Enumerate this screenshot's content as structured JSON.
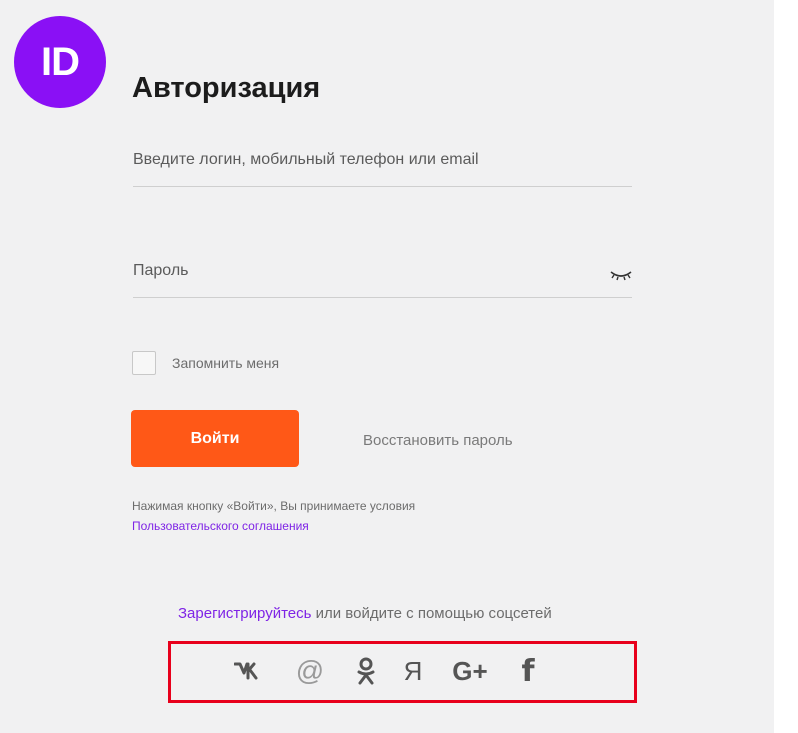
{
  "logo": {
    "text": "ID",
    "color": "#8a10f5"
  },
  "page": {
    "title": "Авторизация"
  },
  "login": {
    "placeholder": "Введите логин, мобильный телефон или email"
  },
  "password": {
    "placeholder": "Пароль",
    "toggle_icon": "eye-closed-icon"
  },
  "remember": {
    "label": "Запомнить меня",
    "checked": false
  },
  "actions": {
    "login_label": "Войти",
    "login_color": "#ff5817",
    "restore_label": "Восстановить пароль"
  },
  "terms": {
    "text": "Нажимая кнопку «Войти», Вы принимаете условия",
    "link": "Пользовательского соглашения"
  },
  "signup": {
    "link": "Зарегистрируйтесь",
    "text": " или войдите с помощью соцсетей"
  },
  "social": {
    "highlight_color": "#e8001c",
    "icons": [
      {
        "name": "vk-icon",
        "glyph": "vk"
      },
      {
        "name": "mail-ru-icon",
        "glyph": "@"
      },
      {
        "name": "odnoklassniki-icon",
        "glyph": "ok"
      },
      {
        "name": "yandex-icon",
        "glyph": "Я"
      },
      {
        "name": "google-plus-icon",
        "glyph": "G+"
      },
      {
        "name": "facebook-icon",
        "glyph": "f"
      }
    ]
  }
}
